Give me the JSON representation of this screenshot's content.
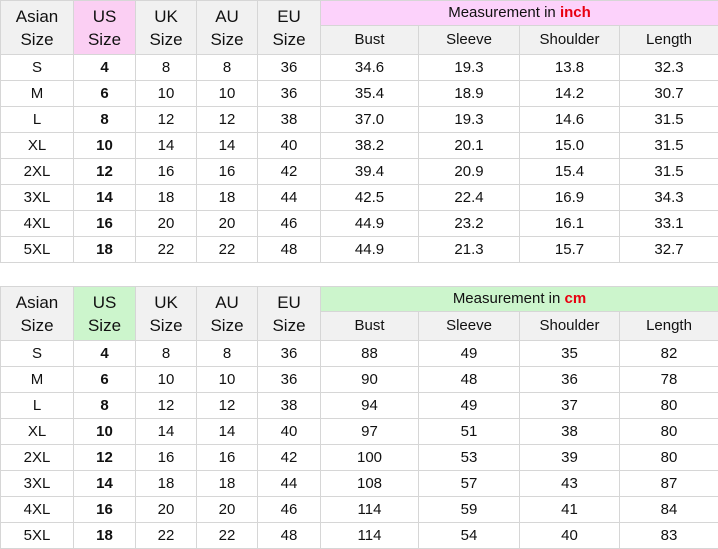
{
  "tables": [
    {
      "id": "inch-table",
      "accent_color": "#fbcff3",
      "banner_color": "#fcd2fb",
      "unit_color": "#e80010",
      "banner": {
        "prefix": "Measurement in ",
        "unit": "inch"
      },
      "size_headers": [
        {
          "line1": "Asian",
          "line2": "Size"
        },
        {
          "line1": "US",
          "line2": "Size"
        },
        {
          "line1": "UK",
          "line2": "Size"
        },
        {
          "line1": "AU",
          "line2": "Size"
        },
        {
          "line1": "EU",
          "line2": "Size"
        }
      ],
      "measure_headers": [
        "Bust",
        "Sleeve",
        "Shoulder",
        "Length"
      ],
      "rows": [
        {
          "asian": "S",
          "us": "4",
          "uk": "8",
          "au": "8",
          "eu": "36",
          "bust": "34.6",
          "sleeve": "19.3",
          "shoulder": "13.8",
          "length": "32.3"
        },
        {
          "asian": "M",
          "us": "6",
          "uk": "10",
          "au": "10",
          "eu": "36",
          "bust": "35.4",
          "sleeve": "18.9",
          "shoulder": "14.2",
          "length": "30.7"
        },
        {
          "asian": "L",
          "us": "8",
          "uk": "12",
          "au": "12",
          "eu": "38",
          "bust": "37.0",
          "sleeve": "19.3",
          "shoulder": "14.6",
          "length": "31.5"
        },
        {
          "asian": "XL",
          "us": "10",
          "uk": "14",
          "au": "14",
          "eu": "40",
          "bust": "38.2",
          "sleeve": "20.1",
          "shoulder": "15.0",
          "length": "31.5"
        },
        {
          "asian": "2XL",
          "us": "12",
          "uk": "16",
          "au": "16",
          "eu": "42",
          "bust": "39.4",
          "sleeve": "20.9",
          "shoulder": "15.4",
          "length": "31.5"
        },
        {
          "asian": "3XL",
          "us": "14",
          "uk": "18",
          "au": "18",
          "eu": "44",
          "bust": "42.5",
          "sleeve": "22.4",
          "shoulder": "16.9",
          "length": "34.3"
        },
        {
          "asian": "4XL",
          "us": "16",
          "uk": "20",
          "au": "20",
          "eu": "46",
          "bust": "44.9",
          "sleeve": "23.2",
          "shoulder": "16.1",
          "length": "33.1"
        },
        {
          "asian": "5XL",
          "us": "18",
          "uk": "22",
          "au": "22",
          "eu": "48",
          "bust": "44.9",
          "sleeve": "21.3",
          "shoulder": "15.7",
          "length": "32.7"
        }
      ]
    },
    {
      "id": "cm-table",
      "accent_color": "#ccf5cc",
      "banner_color": "#ccf5cc",
      "unit_color": "#e80010",
      "banner": {
        "prefix": "Measurement in ",
        "unit": "cm"
      },
      "size_headers": [
        {
          "line1": "Asian",
          "line2": "Size"
        },
        {
          "line1": "US",
          "line2": "Size"
        },
        {
          "line1": "UK",
          "line2": "Size"
        },
        {
          "line1": "AU",
          "line2": "Size"
        },
        {
          "line1": "EU",
          "line2": "Size"
        }
      ],
      "measure_headers": [
        "Bust",
        "Sleeve",
        "Shoulder",
        "Length"
      ],
      "rows": [
        {
          "asian": "S",
          "us": "4",
          "uk": "8",
          "au": "8",
          "eu": "36",
          "bust": "88",
          "sleeve": "49",
          "shoulder": "35",
          "length": "82"
        },
        {
          "asian": "M",
          "us": "6",
          "uk": "10",
          "au": "10",
          "eu": "36",
          "bust": "90",
          "sleeve": "48",
          "shoulder": "36",
          "length": "78"
        },
        {
          "asian": "L",
          "us": "8",
          "uk": "12",
          "au": "12",
          "eu": "38",
          "bust": "94",
          "sleeve": "49",
          "shoulder": "37",
          "length": "80"
        },
        {
          "asian": "XL",
          "us": "10",
          "uk": "14",
          "au": "14",
          "eu": "40",
          "bust": "97",
          "sleeve": "51",
          "shoulder": "38",
          "length": "80"
        },
        {
          "asian": "2XL",
          "us": "12",
          "uk": "16",
          "au": "16",
          "eu": "42",
          "bust": "100",
          "sleeve": "53",
          "shoulder": "39",
          "length": "80"
        },
        {
          "asian": "3XL",
          "us": "14",
          "uk": "18",
          "au": "18",
          "eu": "44",
          "bust": "108",
          "sleeve": "57",
          "shoulder": "43",
          "length": "87"
        },
        {
          "asian": "4XL",
          "us": "16",
          "uk": "20",
          "au": "20",
          "eu": "46",
          "bust": "114",
          "sleeve": "59",
          "shoulder": "41",
          "length": "84"
        },
        {
          "asian": "5XL",
          "us": "18",
          "uk": "22",
          "au": "22",
          "eu": "48",
          "bust": "114",
          "sleeve": "54",
          "shoulder": "40",
          "length": "83"
        }
      ]
    }
  ]
}
